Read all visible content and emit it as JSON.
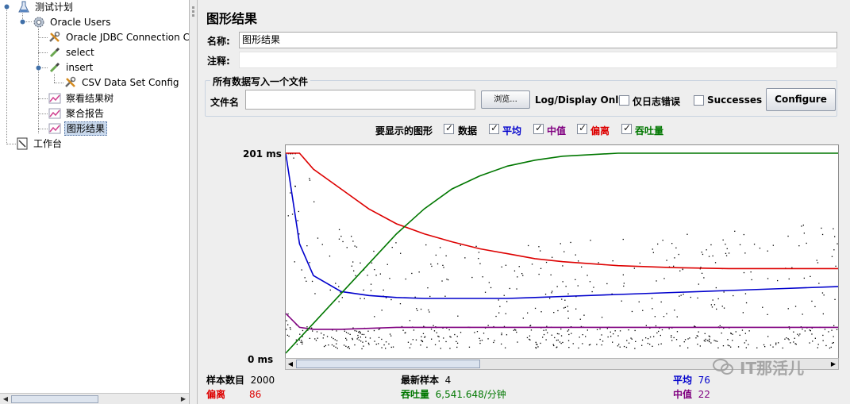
{
  "tree": {
    "items": [
      {
        "label": "测试计划",
        "icon": "flask-icon"
      },
      {
        "label": "Oracle Users",
        "icon": "gear-icon"
      },
      {
        "label": "Oracle JDBC Connection Co",
        "icon": "wrench-icon"
      },
      {
        "label": "select",
        "icon": "pipette-icon"
      },
      {
        "label": "insert",
        "icon": "pipette-icon"
      },
      {
        "label": "CSV Data Set Config",
        "icon": "wrench-icon"
      },
      {
        "label": "察看结果树",
        "icon": "graph-icon"
      },
      {
        "label": "聚合报告",
        "icon": "graph-icon"
      },
      {
        "label": "图形结果",
        "icon": "graph-icon"
      },
      {
        "label": "工作台",
        "icon": "workbench-icon"
      }
    ]
  },
  "panel": {
    "title": "图形结果",
    "name_label": "名称:",
    "name_value": "图形结果",
    "comment_label": "注释:",
    "comment_value": "",
    "file_group_label": "所有数据写入一个文件",
    "filename_label": "文件名",
    "filename_value": "",
    "browse_label": "浏览...",
    "log_display_label": "Log/Display Only:",
    "errors_only_label": "仅日志错误",
    "successes_label": "Successes",
    "configure_label": "Configure"
  },
  "graph_options": {
    "label": "要显示的图形",
    "items": [
      {
        "label": "数据",
        "checked": true,
        "color": "#000000"
      },
      {
        "label": "平均",
        "checked": true,
        "color": "#0000cc"
      },
      {
        "label": "中值",
        "checked": true,
        "color": "#800080"
      },
      {
        "label": "偏离",
        "checked": true,
        "color": "#dd0000"
      },
      {
        "label": "吞吐量",
        "checked": true,
        "color": "#007700"
      }
    ]
  },
  "chart_data": {
    "type": "line",
    "ylabel_max": "201 ms",
    "ylabel_min": "0 ms",
    "ylim": [
      0,
      201
    ],
    "x": [
      0,
      50,
      100,
      200,
      300,
      400,
      500,
      600,
      700,
      800,
      900,
      1000,
      1200,
      1400,
      1600,
      1800,
      2000
    ],
    "series": [
      {
        "name": "平均",
        "color": "#0000cc",
        "values": [
          201,
          110,
          78,
          62,
          58,
          56,
          55,
          55,
          55,
          55,
          56,
          57,
          59,
          61,
          63,
          65,
          67
        ]
      },
      {
        "name": "中值",
        "color": "#800080",
        "values": [
          40,
          26,
          24,
          24,
          25,
          26,
          26,
          26,
          26,
          26,
          26,
          26,
          26,
          26,
          26,
          26,
          26
        ]
      },
      {
        "name": "偏离",
        "color": "#dd0000",
        "values": [
          201,
          201,
          185,
          165,
          145,
          130,
          120,
          112,
          105,
          100,
          95,
          92,
          88,
          86,
          85,
          85,
          85
        ]
      },
      {
        "name": "吞吐量",
        "color": "#007700",
        "values": [
          0,
          15,
          30,
          60,
          90,
          120,
          145,
          165,
          178,
          188,
          194,
          198,
          201,
          201,
          201,
          201,
          201
        ]
      }
    ]
  },
  "stats": {
    "samples_label": "样本数目",
    "samples_value": "2000",
    "latest_label": "最新样本",
    "latest_value": "4",
    "average_label": "平均",
    "average_value": "76",
    "deviation_label": "偏离",
    "deviation_value": "86",
    "throughput_label": "吞吐量",
    "throughput_value": "6,541.648/分钟",
    "median_label": "中值",
    "median_value": "22"
  },
  "watermark": {
    "text": "IT那活儿"
  }
}
